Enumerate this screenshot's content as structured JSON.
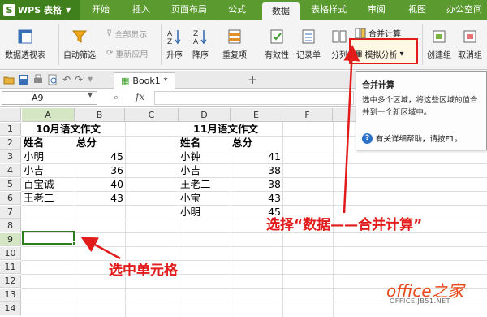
{
  "app": {
    "name": "WPS 表格",
    "logo_letter": "S"
  },
  "menu": [
    "开始",
    "插入",
    "页面布局",
    "公式",
    "数据",
    "表格样式",
    "审阅",
    "视图",
    "办公空间"
  ],
  "menu_active": "数据",
  "ribbon": {
    "pivot": "数据透视表",
    "autofilter": "自动筛选",
    "show_all": "全部显示",
    "reapply": "重新应用",
    "sort_asc": "升序",
    "sort_desc": "降序",
    "duplicates": "重复项",
    "validity": "有效性",
    "record": "记录单",
    "split": "分列",
    "consolidate": "合并计算",
    "whatif": "模拟分析",
    "group": "创建组",
    "ungroup": "取消组"
  },
  "doc_tab": "Book1 *",
  "formula_bar": {
    "name_box": "A9",
    "fx": "fx"
  },
  "columns": [
    "A",
    "B",
    "C",
    "D",
    "E",
    "F"
  ],
  "rows": [
    "1",
    "2",
    "3",
    "4",
    "5",
    "6",
    "7",
    "8",
    "9",
    "10",
    "11",
    "12",
    "13",
    "14"
  ],
  "left_table": {
    "title": "10月语文作文",
    "header_name": "姓名",
    "header_score": "总分",
    "names": [
      "小明",
      "小吉",
      "百宝诚",
      "王老二"
    ],
    "scores": [
      "45",
      "36",
      "40",
      "43"
    ]
  },
  "right_table": {
    "title": "11月语文作文",
    "header_name": "姓名",
    "header_score": "总分",
    "names": [
      "小钟",
      "小吉",
      "王老二",
      "小宝",
      "小明"
    ],
    "scores": [
      "41",
      "38",
      "38",
      "43",
      "45"
    ]
  },
  "tooltip": {
    "title": "合并计算",
    "body": "选中多个区域，将这些区域的值合并到一个新区域中。",
    "help": "有关详细帮助，请按F1。"
  },
  "annotations": {
    "select_data": "选择“数据——合并计算”",
    "select_cell": "选中单元格"
  },
  "watermark": {
    "main": "office之家",
    "sub": "OFFICE.JB51.NET"
  },
  "colors": {
    "menubar": "#5a9a2e",
    "annotation": "#e21b1b",
    "selection": "#2d7d1c"
  }
}
